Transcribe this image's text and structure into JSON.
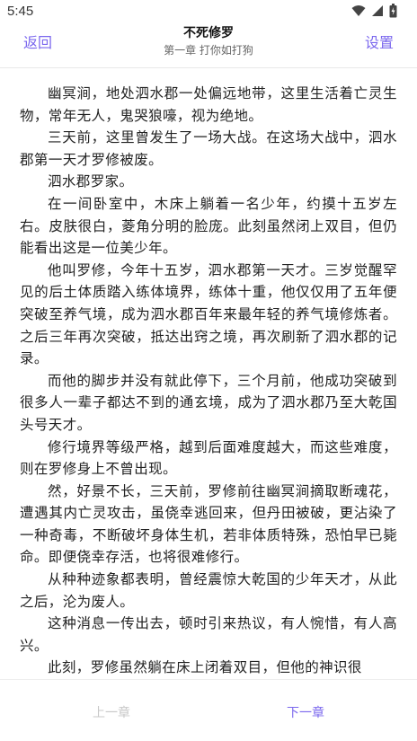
{
  "status_bar": {
    "time": "5:45"
  },
  "app_bar": {
    "back_label": "返回",
    "book_title": "不死修罗",
    "chapter_title": "第一章 打你如打狗",
    "settings_label": "设置",
    "accent_color": "#7b68ee"
  },
  "content": {
    "paragraphs": [
      "幽冥涧，地处泗水郡一处偏远地带，这里生活着亡灵生物，常年无人，鬼哭狼嚎，视为绝地。",
      "三天前，这里曾发生了一场大战。在这场大战中，泗水郡第一天才罗修被废。",
      "泗水郡罗家。",
      "在一间卧室中，木床上躺着一名少年，约摸十五岁左右。皮肤很白，菱角分明的脸庞。此刻虽然闭上双目，但仍能看出这是一位美少年。",
      "他叫罗修，今年十五岁，泗水郡第一天才。三岁觉醒罕见的后土体质踏入练体境界，练体十重，他仅仅用了五年便突破至养气境，成为泗水郡百年来最年轻的养气境修炼者。之后三年再次突破，抵达出窍之境，再次刷新了泗水郡的记录。",
      "而他的脚步并没有就此停下，三个月前，他成功突破到很多人一辈子都达不到的通玄境，成为了泗水郡乃至大乾国头号天才。",
      "修行境界等级严格，越到后面难度越大，而这些难度，则在罗修身上不曾出现。",
      "然，好景不长，三天前，罗修前往幽冥涧摘取断魂花，遭遇其内亡灵攻击，虽侥幸逃回来，但丹田被破，更沾染了一种奇毒，不断破坏身体生机，若非体质特殊，恐怕早已毙命。即便侥幸存活，也将很难修行。",
      "从种种迹象都表明，曾经震惊大乾国的少年天才，从此之后，沦为废人。",
      "这种消息一传出去，顿时引来热议，有人惋惜，有人高兴。",
      "此刻，罗修虽然躺在床上闭着双目，但他的神识很"
    ]
  },
  "bottom_bar": {
    "prev_label": "上一章",
    "next_label": "下一章"
  }
}
